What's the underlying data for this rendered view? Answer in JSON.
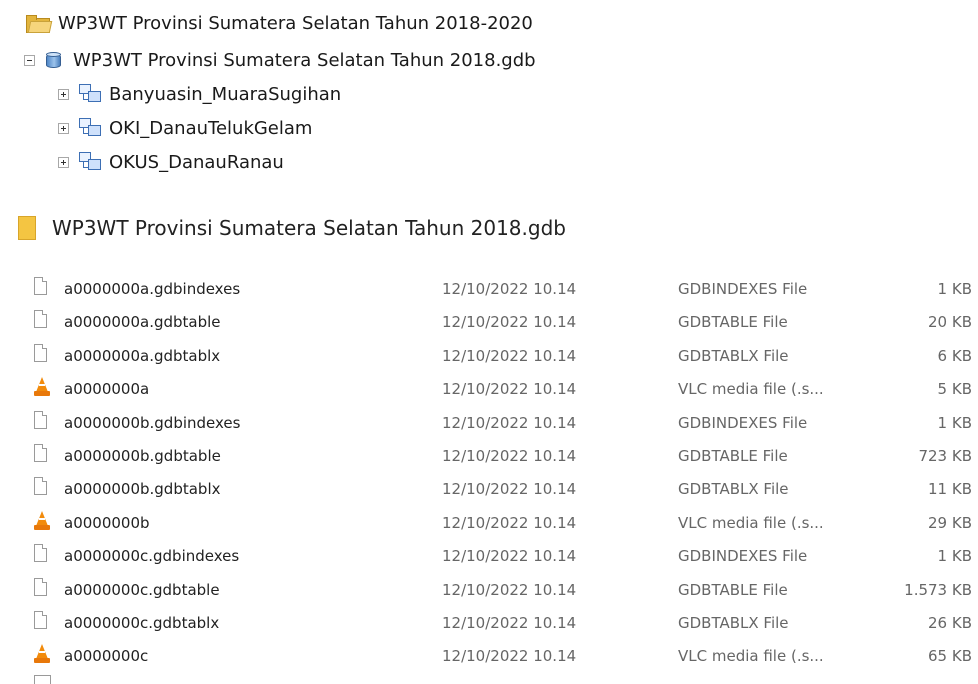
{
  "tree": {
    "root_label": "WP3WT Provinsi Sumatera Selatan Tahun 2018-2020",
    "gdb_label": "WP3WT Provinsi Sumatera Selatan Tahun 2018.gdb",
    "feature_datasets": [
      "Banyuasin_MuaraSugihan",
      "OKI_DanauTelukGelam",
      "OKUS_DanauRanau"
    ]
  },
  "folder": {
    "title": "WP3WT Provinsi Sumatera Selatan Tahun 2018.gdb"
  },
  "files": [
    {
      "name": "a0000000a.gdbindexes",
      "date": "12/10/2022 10.14",
      "type": "GDBINDEXES File",
      "size": "1 KB",
      "icon": "file-icon"
    },
    {
      "name": "a0000000a.gdbtable",
      "date": "12/10/2022 10.14",
      "type": "GDBTABLE File",
      "size": "20 KB",
      "icon": "file-icon"
    },
    {
      "name": "a0000000a.gdbtablx",
      "date": "12/10/2022 10.14",
      "type": "GDBTABLX File",
      "size": "6 KB",
      "icon": "file-icon"
    },
    {
      "name": "a0000000a",
      "date": "12/10/2022 10.14",
      "type": "VLC media file (.s...",
      "size": "5 KB",
      "icon": "vlc-icon"
    },
    {
      "name": "a0000000b.gdbindexes",
      "date": "12/10/2022 10.14",
      "type": "GDBINDEXES File",
      "size": "1 KB",
      "icon": "file-icon"
    },
    {
      "name": "a0000000b.gdbtable",
      "date": "12/10/2022 10.14",
      "type": "GDBTABLE File",
      "size": "723 KB",
      "icon": "file-icon"
    },
    {
      "name": "a0000000b.gdbtablx",
      "date": "12/10/2022 10.14",
      "type": "GDBTABLX File",
      "size": "11 KB",
      "icon": "file-icon"
    },
    {
      "name": "a0000000b",
      "date": "12/10/2022 10.14",
      "type": "VLC media file (.s...",
      "size": "29 KB",
      "icon": "vlc-icon"
    },
    {
      "name": "a0000000c.gdbindexes",
      "date": "12/10/2022 10.14",
      "type": "GDBINDEXES File",
      "size": "1 KB",
      "icon": "file-icon"
    },
    {
      "name": "a0000000c.gdbtable",
      "date": "12/10/2022 10.14",
      "type": "GDBTABLE File",
      "size": "1.573 KB",
      "icon": "file-icon"
    },
    {
      "name": "a0000000c.gdbtablx",
      "date": "12/10/2022 10.14",
      "type": "GDBTABLX File",
      "size": "26 KB",
      "icon": "file-icon"
    },
    {
      "name": "a0000000c",
      "date": "12/10/2022 10.14",
      "type": "VLC media file (.s...",
      "size": "65 KB",
      "icon": "vlc-icon"
    }
  ]
}
